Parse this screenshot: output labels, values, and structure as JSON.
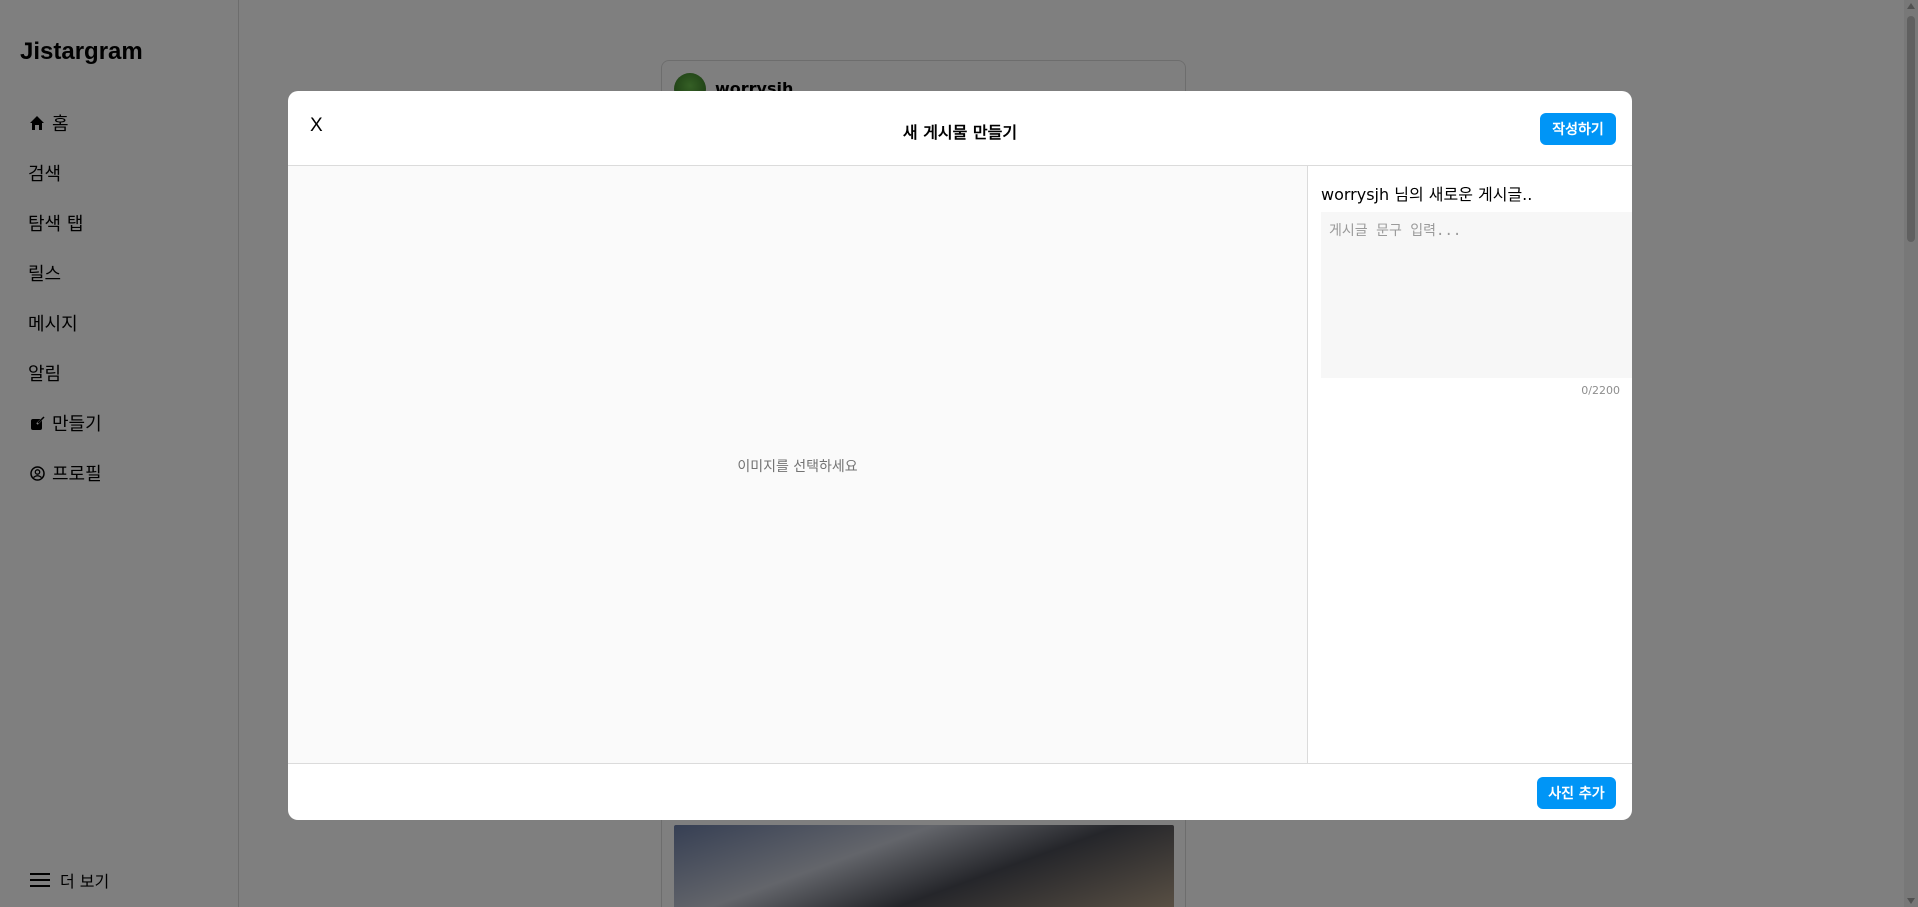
{
  "app": {
    "title": "Jistargram"
  },
  "sidebar": {
    "items": [
      {
        "label": "홈",
        "icon": "home-icon"
      },
      {
        "label": "검색"
      },
      {
        "label": "탐색 탭"
      },
      {
        "label": "릴스"
      },
      {
        "label": "메시지"
      },
      {
        "label": "알림"
      },
      {
        "label": "만들기",
        "icon": "create-icon"
      },
      {
        "label": "프로필",
        "icon": "profile-icon"
      }
    ],
    "more_label": "더 보기"
  },
  "feed": {
    "username": "worrysjh"
  },
  "modal": {
    "close_label": "X",
    "title": "새 게시물 만들기",
    "submit_label": "작성하기",
    "image_placeholder": "이미지를 선택하세요",
    "author_line": "worrysjh 님의 새로운 게시글..",
    "caption_placeholder": "게시글 문구 입력...",
    "counter": "0/2200",
    "add_photo_label": "사진 추가"
  },
  "colors": {
    "accent": "#0095f6",
    "overlay": "rgba(0,0,0,0.5)"
  }
}
